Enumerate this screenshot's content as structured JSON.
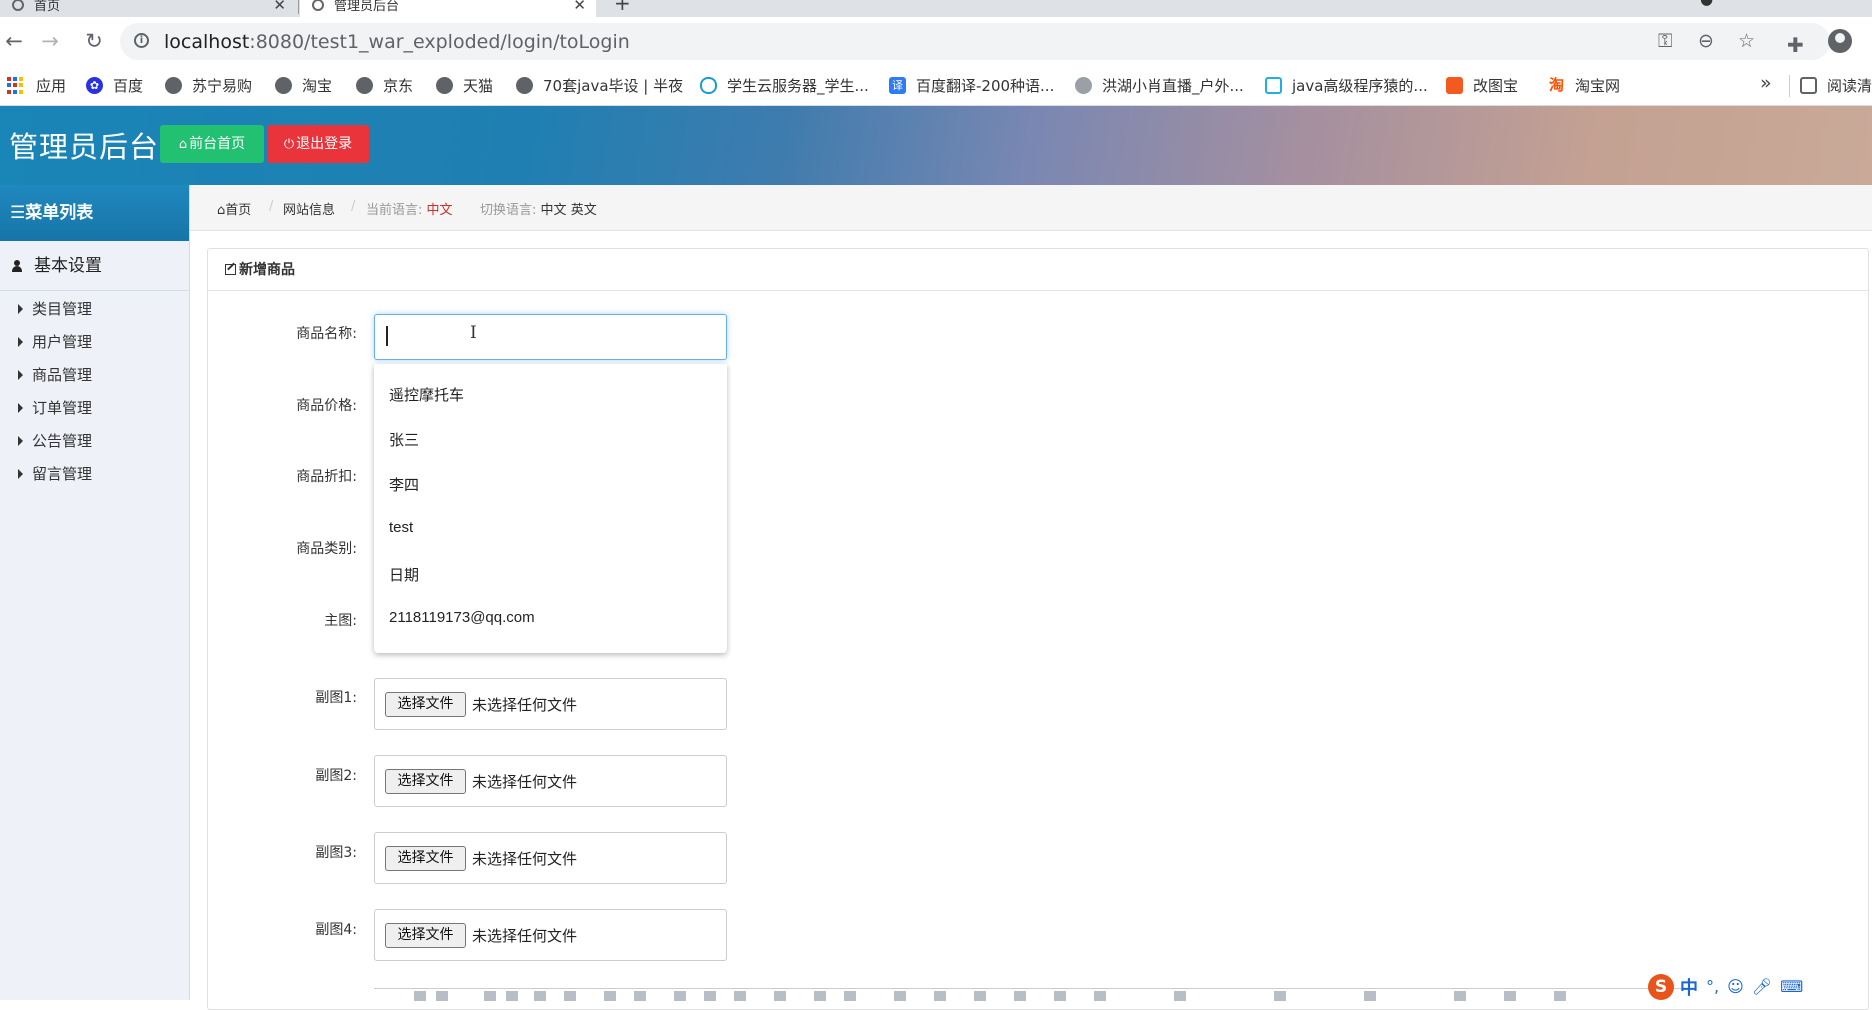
{
  "browser": {
    "tabs": [
      {
        "title": "首页"
      },
      {
        "title": "管理员后台"
      }
    ],
    "url_host": "localhost",
    "url_rest": ":8080/test1_war_exploded/login/toLogin",
    "bookmarks": [
      {
        "label": "应用",
        "icon": "apps-grid-icon"
      },
      {
        "label": "百度",
        "icon": "baidu-paw-icon"
      },
      {
        "label": "苏宁易购",
        "icon": "globe-icon"
      },
      {
        "label": "淘宝",
        "icon": "globe-icon"
      },
      {
        "label": "京东",
        "icon": "globe-icon"
      },
      {
        "label": "天猫",
        "icon": "globe-icon"
      },
      {
        "label": "70套java毕设 | 半夜",
        "icon": "globe-icon"
      },
      {
        "label": "学生云服务器_学生...",
        "icon": "cloud-icon"
      },
      {
        "label": "百度翻译-200种语...",
        "icon": "translate-icon"
      },
      {
        "label": "洪湖小肖直播_户外...",
        "icon": "mascot-icon"
      },
      {
        "label": "java高级程序猿的...",
        "icon": "bilibili-icon"
      },
      {
        "label": "改图宝",
        "icon": "image-edit-icon"
      },
      {
        "label": "淘宝网",
        "icon": "taobao-icon"
      }
    ],
    "reading_list": "阅读清"
  },
  "header": {
    "title": "管理员后台",
    "home_button": "前台首页",
    "logout_button": "退出登录"
  },
  "sidebar": {
    "menu_title": "菜单列表",
    "group": "基本设置",
    "items": [
      {
        "label": "类目管理"
      },
      {
        "label": "用户管理"
      },
      {
        "label": "商品管理"
      },
      {
        "label": "订单管理"
      },
      {
        "label": "公告管理"
      },
      {
        "label": "留言管理"
      }
    ]
  },
  "breadcrumb": {
    "home": "首页",
    "site_info": "网站信息",
    "current_lang_label": "当前语言:",
    "current_lang": "中文",
    "switch_label": "切换语言:",
    "lang_zh": "中文",
    "lang_en": "英文"
  },
  "form": {
    "panel_title": "新增商品",
    "labels": {
      "name": "商品名称:",
      "price": "商品价格:",
      "discount": "商品折扣:",
      "category": "商品类别:",
      "main_image": "主图:",
      "sub1": "副图1:",
      "sub2": "副图2:",
      "sub3": "副图3:",
      "sub4": "副图4:"
    },
    "name_value": "",
    "autocomplete": [
      "遥控摩托车",
      "张三",
      "李四",
      "test",
      "日期",
      "2118119173@qq.com"
    ],
    "file_button": "选择文件",
    "file_status": "未选择任何文件"
  },
  "ime": {
    "label": "中"
  }
}
